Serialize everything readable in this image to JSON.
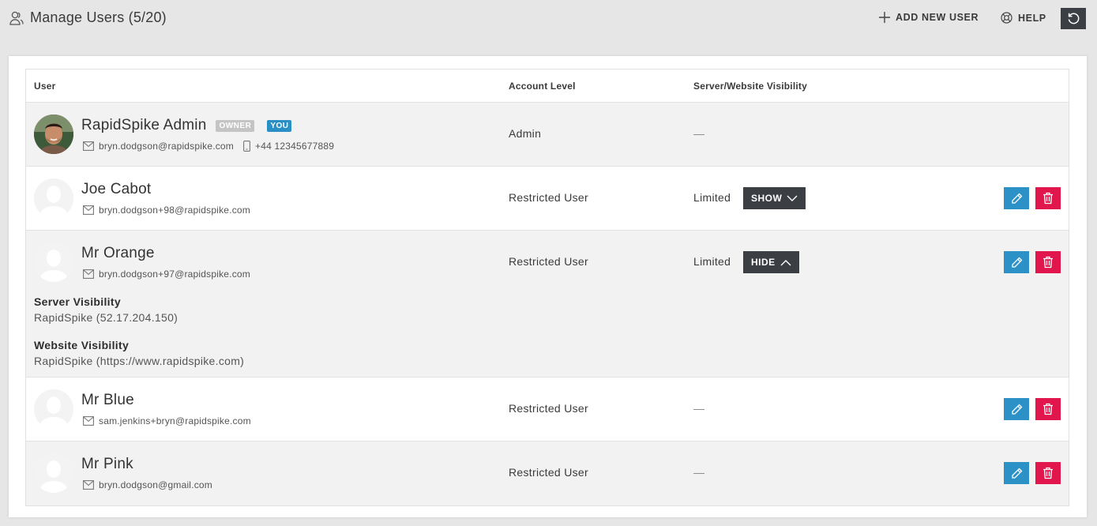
{
  "header": {
    "title": "Manage Users (5/20)",
    "add_user_label": "ADD NEW USER",
    "help_label": "HELP"
  },
  "table": {
    "columns": [
      "User",
      "Account Level",
      "Server/Website Visibility"
    ]
  },
  "users": [
    {
      "name": "RapidSpike Admin",
      "badges": [
        "OWNER",
        "YOU"
      ],
      "email": "bryn.dodgson@rapidspike.com",
      "phone": "+44 12345677889",
      "level": "Admin",
      "visibility": "—"
    },
    {
      "name": "Joe Cabot",
      "email": "bryn.dodgson+98@rapidspike.com",
      "level": "Restricted User",
      "visibility": "Limited",
      "toggle_label": "SHOW"
    },
    {
      "name": "Mr Orange",
      "email": "bryn.dodgson+97@rapidspike.com",
      "level": "Restricted User",
      "visibility": "Limited",
      "toggle_label": "HIDE",
      "server_visibility_heading": "Server Visibility",
      "server_visibility_value": "RapidSpike (52.17.204.150)",
      "website_visibility_heading": "Website Visibility",
      "website_visibility_value": "RapidSpike (https://www.rapidspike.com)"
    },
    {
      "name": "Mr Blue",
      "email": "sam.jenkins+bryn@rapidspike.com",
      "level": "Restricted User",
      "visibility": "—"
    },
    {
      "name": "Mr Pink",
      "email": "bryn.dodgson@gmail.com",
      "level": "Restricted User",
      "visibility": "—"
    }
  ],
  "colors": {
    "edit": "#2b91c6",
    "delete": "#e0164d",
    "dark_button": "#3b3e43",
    "you_badge": "#2a8fc4",
    "owner_badge": "#c4c4c4"
  },
  "icons": {
    "title": "users-icon",
    "add": "plus-icon",
    "help": "lifebuoy-icon",
    "refresh": "refresh-icon",
    "email": "envelope-icon",
    "phone": "mobile-phone-icon",
    "edit": "pencil-icon",
    "delete": "trash-icon"
  }
}
